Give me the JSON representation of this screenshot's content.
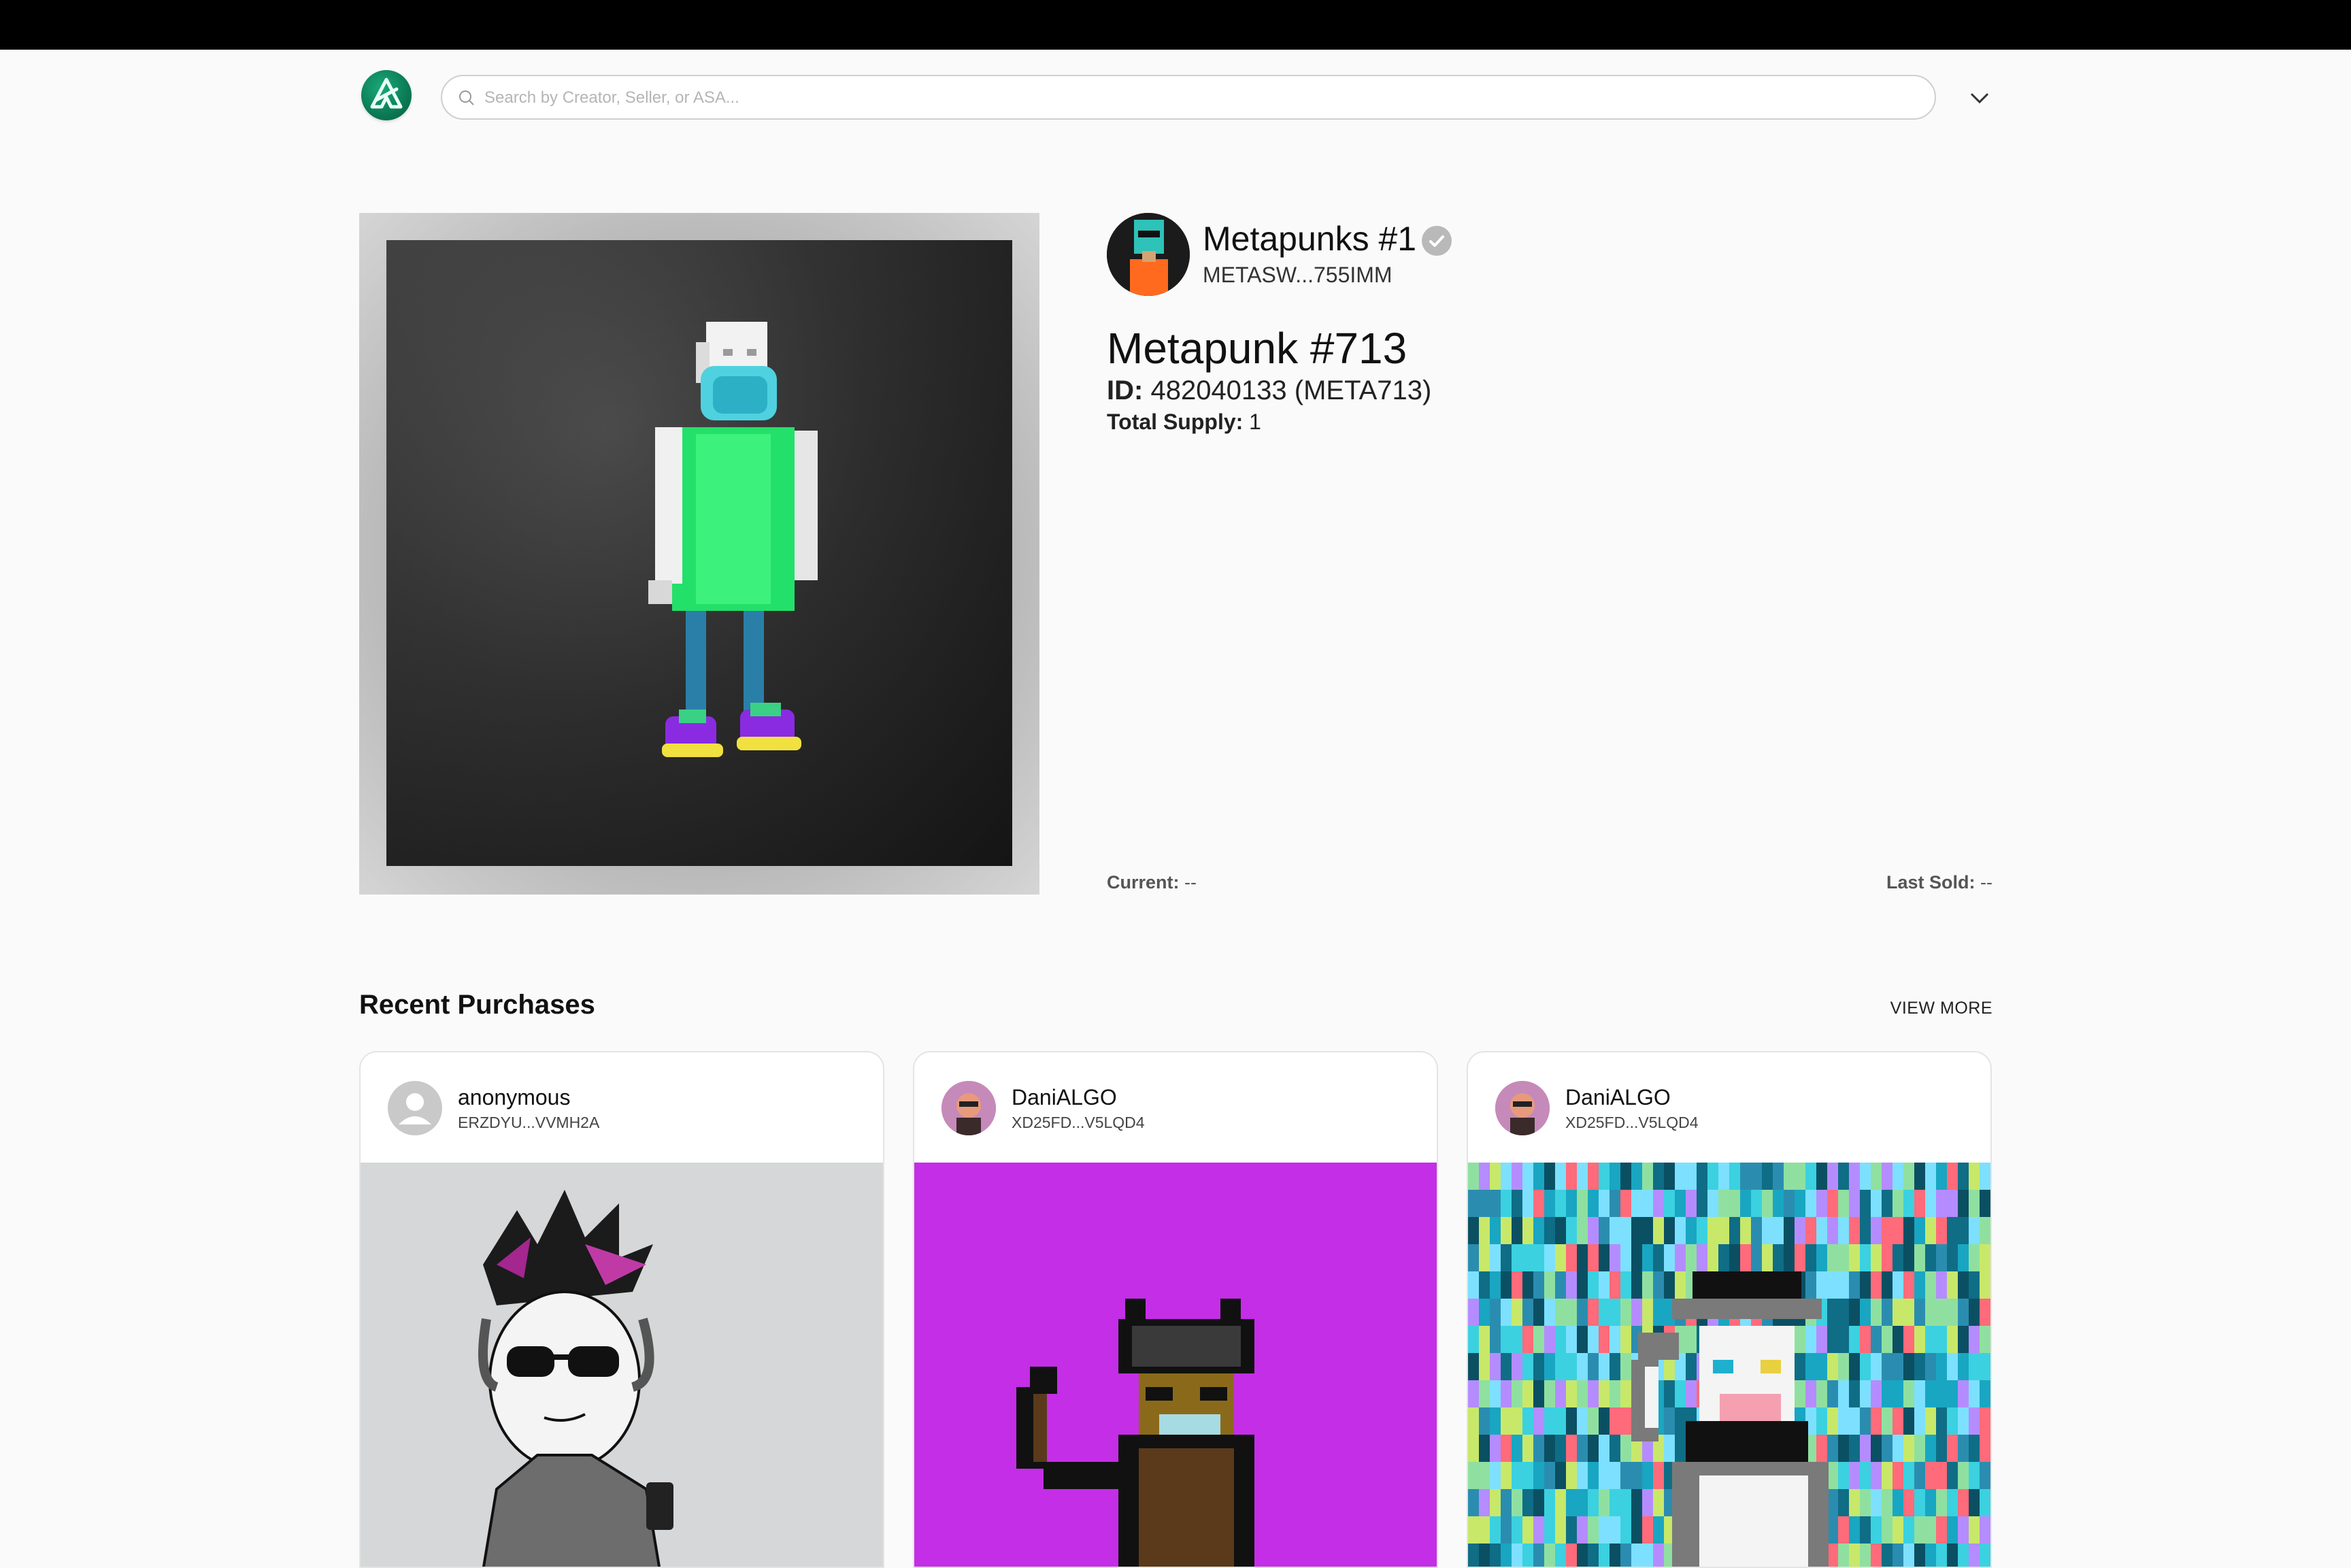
{
  "header": {
    "search_placeholder": "Search by Creator, Seller, or ASA..."
  },
  "collection": {
    "name": "Metapunks #1",
    "address": "METASW...755IMM"
  },
  "asset": {
    "title": "Metapunk #713",
    "id_label": "ID:",
    "id_value": "482040133 (META713)",
    "supply_label": "Total Supply:",
    "supply_value": "1"
  },
  "prices": {
    "current_label": "Current:",
    "current_value": "--",
    "last_sold_label": "Last Sold:",
    "last_sold_value": "--"
  },
  "recent": {
    "title": "Recent Purchases",
    "view_more": "VIEW MORE",
    "cards": [
      {
        "name": "anonymous",
        "address": "ERZDYU...VVMH2A"
      },
      {
        "name": "DaniALGO",
        "address": "XD25FD...V5LQD4"
      },
      {
        "name": "DaniALGO",
        "address": "XD25FD...V5LQD4"
      }
    ]
  },
  "colors": {
    "accent_green": "#0b7a55",
    "card2_bg": "#c42ee6",
    "card1_bg": "#d6d7d8"
  }
}
